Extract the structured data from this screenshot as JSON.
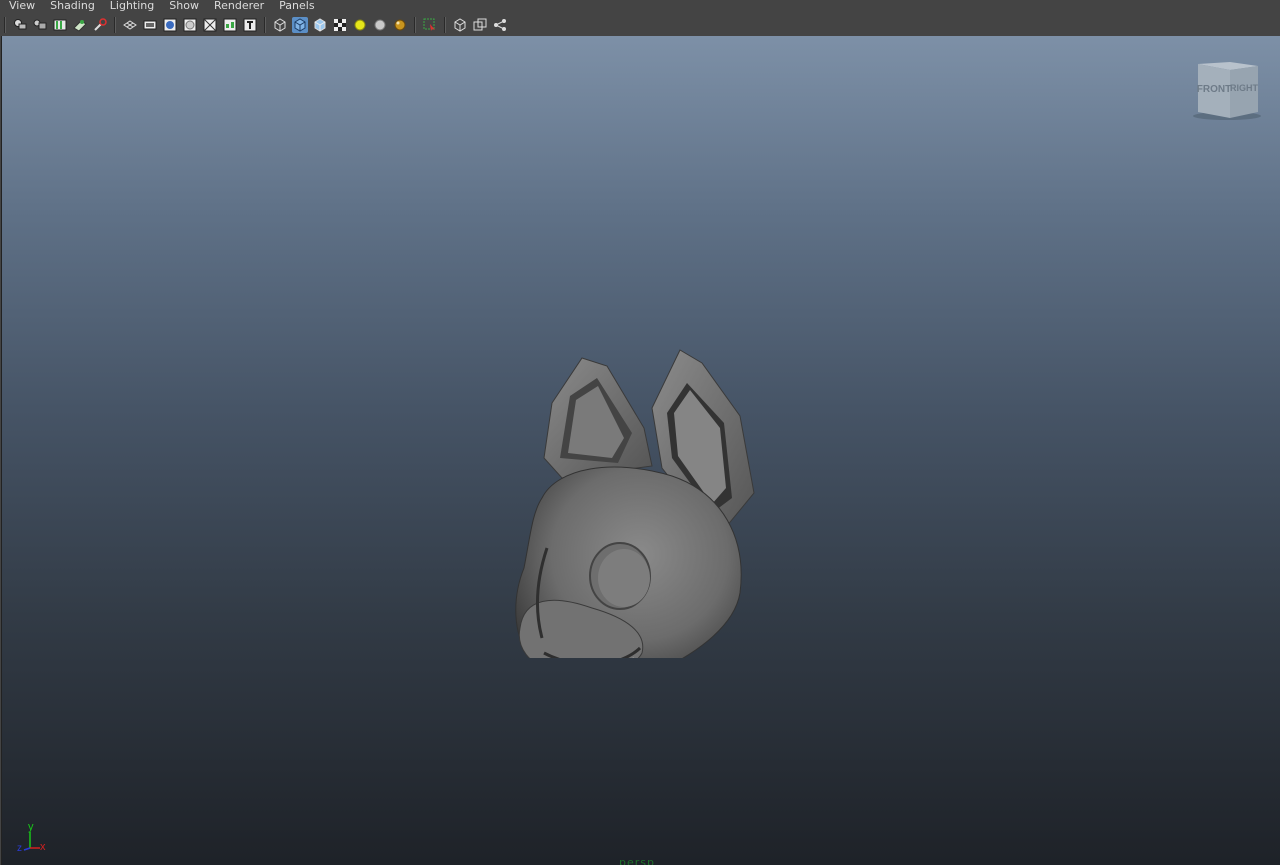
{
  "menubar": {
    "items": [
      "View",
      "Shading",
      "Lighting",
      "Show",
      "Renderer",
      "Panels"
    ]
  },
  "toolbar": {
    "icons": [
      "select-camera-icon",
      "camera-attributes-icon",
      "bookmarks-icon",
      "image-plane-icon",
      "2d-pan-zoom-icon",
      "grid-icon",
      "film-gate-icon",
      "resolution-gate-icon",
      "gate-mask-icon",
      "field-chart-icon",
      "safe-action-icon",
      "safe-title-icon",
      "wireframe-icon",
      "smooth-shade-icon",
      "default-material-icon",
      "textured-icon",
      "use-default-lighting-icon",
      "all-lights-icon",
      "shadows-icon",
      "isolate-select-icon",
      "xray-icon",
      "xray-active-components-icon",
      "xray-joints-icon"
    ],
    "active_icon": "smooth-shade-icon",
    "accent_color": "#5b8fc7"
  },
  "viewport": {
    "viewcube": {
      "front_label": "FRONT",
      "right_label": "RIGHT"
    },
    "axis": {
      "x_label": "x",
      "y_label": "y",
      "z_label": "z",
      "x_color": "#d42020",
      "y_color": "#19c419",
      "z_color": "#2a3bd6"
    },
    "camera_label": "persp",
    "model": "cartoon-fox-head-icon"
  }
}
